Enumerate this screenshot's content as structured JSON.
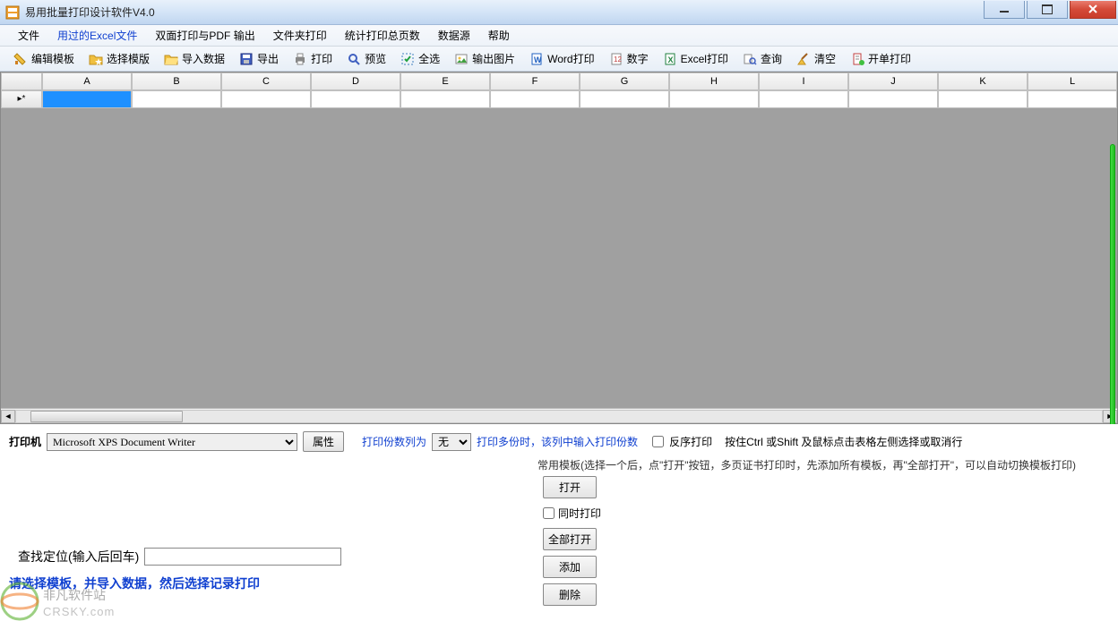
{
  "window": {
    "title": "易用批量打印设计软件V4.0"
  },
  "menubar": [
    {
      "label": "文件",
      "key": "file"
    },
    {
      "label": "用过的Excel文件",
      "key": "recent",
      "highlight": true
    },
    {
      "label": "双面打印与PDF 输出",
      "key": "duplex"
    },
    {
      "label": "文件夹打印",
      "key": "folder"
    },
    {
      "label": "统计打印总页数",
      "key": "stats"
    },
    {
      "label": "数据源",
      "key": "datasource"
    },
    {
      "label": "帮助",
      "key": "help"
    }
  ],
  "toolbar": [
    {
      "label": "编辑模板",
      "icon": "pencil",
      "key": "edit-template"
    },
    {
      "label": "选择模版",
      "icon": "folder-star",
      "key": "select-template"
    },
    {
      "label": "导入数据",
      "icon": "folder-open",
      "key": "import-data"
    },
    {
      "label": "导出",
      "icon": "save",
      "key": "export"
    },
    {
      "label": "打印",
      "icon": "printer",
      "key": "print"
    },
    {
      "label": "预览",
      "icon": "search",
      "key": "preview"
    },
    {
      "label": "全选",
      "icon": "select-all",
      "key": "select-all"
    },
    {
      "label": "输出图片",
      "icon": "image",
      "key": "output-image"
    },
    {
      "label": "Word打印",
      "icon": "word",
      "key": "word-print"
    },
    {
      "label": "数字",
      "icon": "number",
      "key": "number"
    },
    {
      "label": "Excel打印",
      "icon": "excel",
      "key": "excel-print"
    },
    {
      "label": "查询",
      "icon": "find",
      "key": "query"
    },
    {
      "label": "清空",
      "icon": "broom",
      "key": "clear"
    },
    {
      "label": "开单打印",
      "icon": "receipt",
      "key": "open-print"
    }
  ],
  "grid": {
    "columns": [
      "A",
      "B",
      "C",
      "D",
      "E",
      "F",
      "G",
      "H",
      "I",
      "J",
      "K",
      "L"
    ],
    "row_indicator": "▸*",
    "selected_cell": "A1"
  },
  "printer": {
    "label": "打印机",
    "value": "Microsoft XPS Document Writer",
    "properties_btn": "属性"
  },
  "copies": {
    "prefix": "打印份数列为",
    "value": "无",
    "hint": "打印多份时，该列中输入打印份数"
  },
  "reverse": {
    "label": "反序打印",
    "checked": false
  },
  "selection_hint": "按住Ctrl 或Shift 及鼠标点击表格左侧选择或取消行",
  "templates_hint": "常用模板(选择一个后，点\"打开\"按钮，多页证书打印时，先添加所有模板，再\"全部打开\"，可以自动切换模板打印)",
  "template_buttons": {
    "open": "打开",
    "simul_print": "同时打印",
    "open_all": "全部打开",
    "add": "添加",
    "delete": "删除"
  },
  "simul_checked": false,
  "find": {
    "label": "查找定位(输入后回车)",
    "value": ""
  },
  "status_msg": "请选择模板，并导入数据，然后选择记录打印",
  "watermark": {
    "brand": "非凡软件站",
    "domain": "CRSKY.com"
  }
}
